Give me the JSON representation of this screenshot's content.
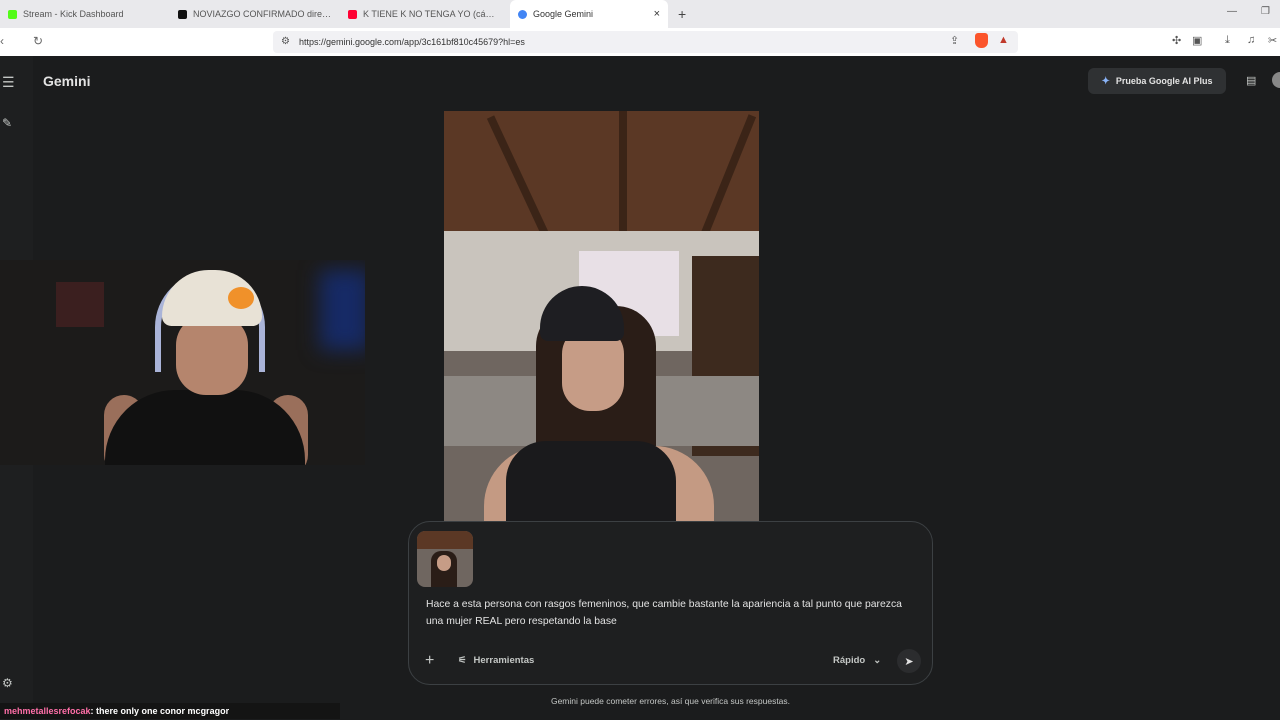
{
  "browser": {
    "tabs": [
      {
        "title": "Stream - Kick Dashboard",
        "favicon_color": "#53fc18",
        "active": false
      },
      {
        "title": "NOVIAZGO CONFIRMADO directos",
        "favicon_color": "#111111",
        "active": false
      },
      {
        "title": "K TIENE K NO TENGA YO (cámara",
        "favicon_color": "#ff0033",
        "active": false
      },
      {
        "title": "Google Gemini",
        "favicon_color": "#4285f4",
        "active": true
      }
    ],
    "close_tab_glyph": "×",
    "new_tab_glyph": "+",
    "url": "https://gemini.google.com/app/3c161bf810c45679?hl=es"
  },
  "app": {
    "brand": "Gemini",
    "upgrade_button": "Prueba Google AI Plus"
  },
  "composer": {
    "prompt_text": "Hace a esta persona con rasgos femeninos, que cambie bastante la apariencia a tal punto que parezca una mujer REAL pero respetando la base",
    "tools_label": "Herramientas",
    "mode_label": "Rápido"
  },
  "footer": {
    "disclaimer": "Gemini puede cometer errores, así que verifica sus respuestas."
  },
  "stream_chat": {
    "username": "mehmetallesrefocak",
    "message": ": there only one conor mcgragor"
  },
  "icons": {
    "menu": "hamburger-icon",
    "new_chat": "edit-icon",
    "settings": "gear-icon",
    "add": "plus-icon",
    "tools": "sliders-icon",
    "mode": "chevron-down-icon",
    "send": "send-icon"
  }
}
